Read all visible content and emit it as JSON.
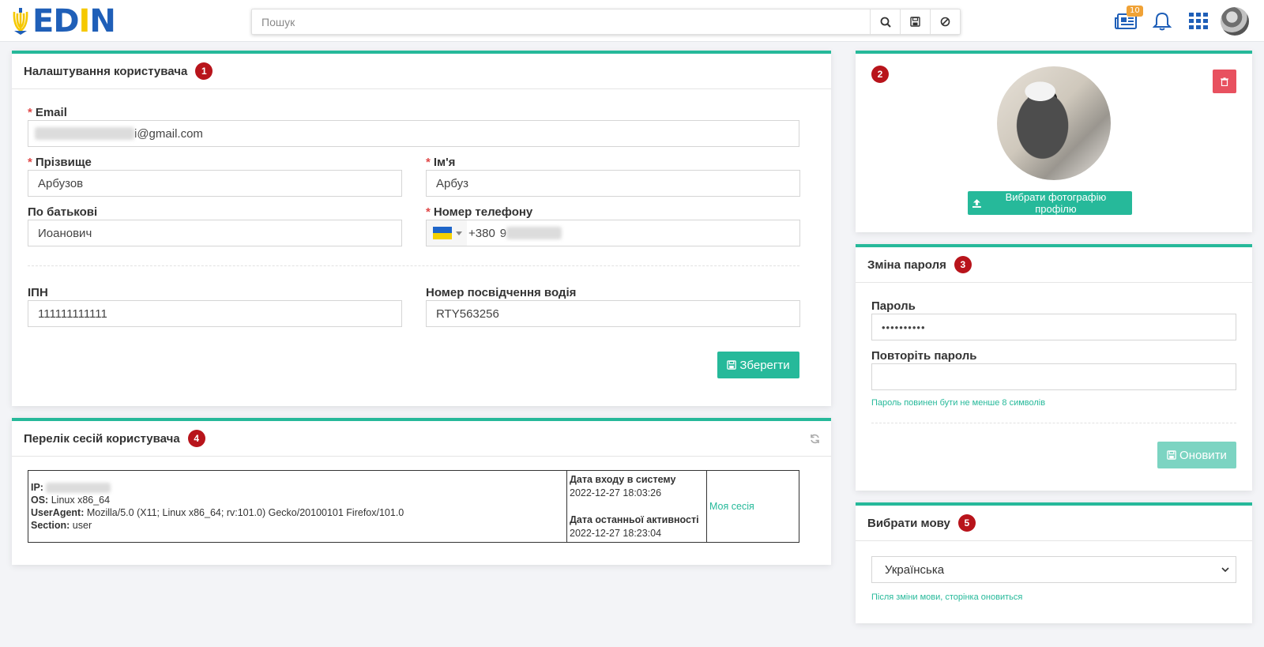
{
  "header": {
    "logo": "EDIN",
    "search": {
      "placeholder": "Пошук"
    },
    "news_badge": "10",
    "icons": [
      "newspaper-icon",
      "bell-icon",
      "apps-grid-icon",
      "avatar"
    ]
  },
  "user_settings": {
    "title": "Налаштування користувача",
    "badge": "1",
    "email": {
      "label": "Email",
      "value_visible": "i@gmail.com"
    },
    "last_name": {
      "label": "Прізвище",
      "value": "Арбузов"
    },
    "first_name": {
      "label": "Ім'я",
      "value": "Арбуз"
    },
    "patronymic": {
      "label": "По батькові",
      "value": "Иоанович"
    },
    "phone": {
      "label": "Номер телефону",
      "code": "+380",
      "value_visible": "9"
    },
    "ipn": {
      "label": "ІПН",
      "value": "111111111111"
    },
    "driver_license": {
      "label": "Номер посвідчення водія",
      "value": "RTY563256"
    },
    "save_label": "Зберегти"
  },
  "sessions": {
    "title": "Перелік сесій користувача",
    "badge": "4",
    "row": {
      "ip_label": "IP:",
      "os_label": "OS:",
      "os": "Linux x86_64",
      "ua_label": "UserAgent:",
      "ua": "Mozilla/5.0 (X11; Linux x86_64; rv:101.0) Gecko/20100101 Firefox/101.0",
      "section_label": "Section:",
      "section": "user",
      "login_label": "Дата входу в систему",
      "login": "2022-12-27 18:03:26",
      "activity_label": "Дата останньої активності",
      "activity": "2022-12-27 18:23:04",
      "status": "Моя сесія"
    }
  },
  "profile_photo": {
    "badge": "2",
    "choose_label": "Вибрати фотографію профілю"
  },
  "password": {
    "title": "Зміна пароля",
    "badge": "3",
    "password_label": "Пароль",
    "password_value": "••••••••••",
    "repeat_label": "Повторіть пароль",
    "hint": "Пароль повинен бути не менше 8 символів",
    "update_label": "Оновити"
  },
  "language": {
    "title": "Вибрати мову",
    "badge": "5",
    "selected": "Українська",
    "hint": "Після зміни мови, сторінка оновиться"
  },
  "colors": {
    "accent": "#26b99a",
    "badge_red": "#b8141b",
    "delete_red": "#e8515f"
  }
}
